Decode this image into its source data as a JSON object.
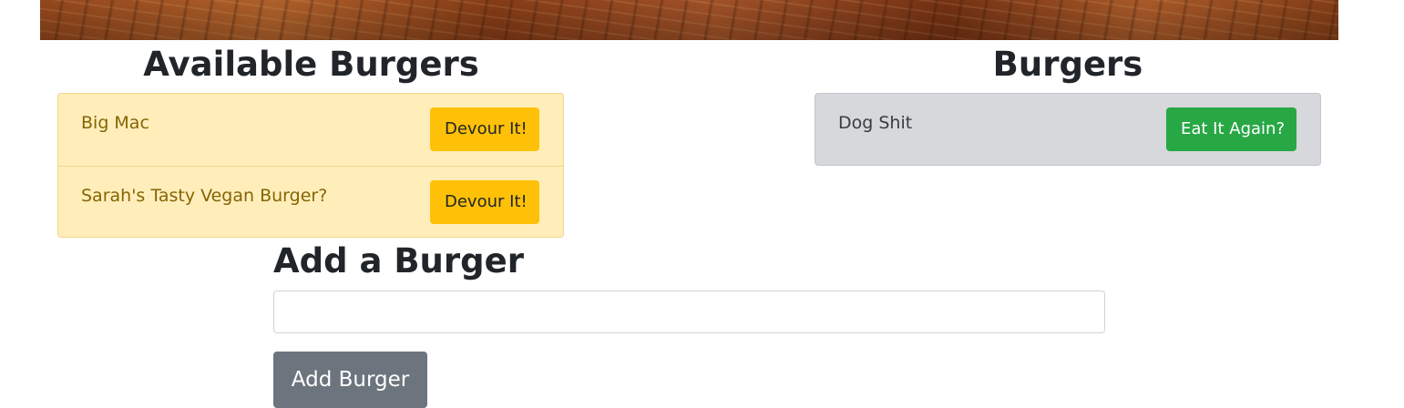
{
  "available": {
    "title": "Available Burgers",
    "items": [
      {
        "name": "Big Mac",
        "button": "Devour It!"
      },
      {
        "name": "Sarah's Tasty Vegan Burger?",
        "button": "Devour It!"
      }
    ]
  },
  "devoured": {
    "title": "Burgers",
    "items": [
      {
        "name": "Dog Shit",
        "button": "Eat It Again?"
      }
    ]
  },
  "form": {
    "title": "Add a Burger",
    "input_value": "",
    "submit_label": "Add Burger"
  },
  "colors": {
    "available_bg": "#ffeeba",
    "devour_button": "#ffc107",
    "devoured_bg": "#d6d8db",
    "eat_again_button": "#28a745",
    "submit_button": "#6c757d"
  }
}
